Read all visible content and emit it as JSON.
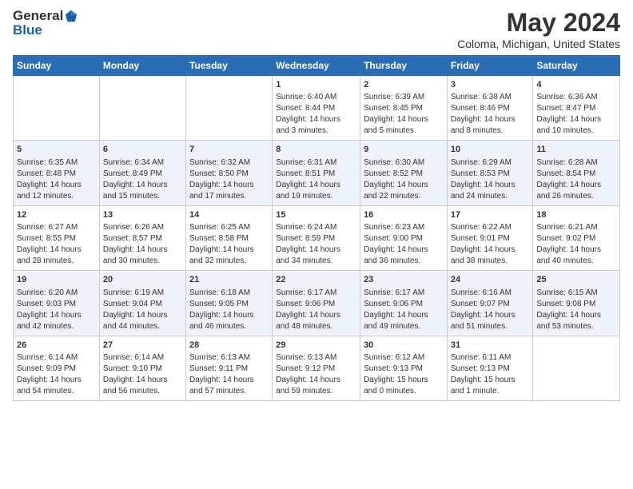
{
  "header": {
    "logo_general": "General",
    "logo_blue": "Blue",
    "title": "May 2024",
    "subtitle": "Coloma, Michigan, United States"
  },
  "days_of_week": [
    "Sunday",
    "Monday",
    "Tuesday",
    "Wednesday",
    "Thursday",
    "Friday",
    "Saturday"
  ],
  "weeks": [
    [
      {
        "day": "",
        "content": ""
      },
      {
        "day": "",
        "content": ""
      },
      {
        "day": "",
        "content": ""
      },
      {
        "day": "1",
        "content": "Sunrise: 6:40 AM\nSunset: 8:44 PM\nDaylight: 14 hours\nand 3 minutes."
      },
      {
        "day": "2",
        "content": "Sunrise: 6:39 AM\nSunset: 8:45 PM\nDaylight: 14 hours\nand 5 minutes."
      },
      {
        "day": "3",
        "content": "Sunrise: 6:38 AM\nSunset: 8:46 PM\nDaylight: 14 hours\nand 8 minutes."
      },
      {
        "day": "4",
        "content": "Sunrise: 6:36 AM\nSunset: 8:47 PM\nDaylight: 14 hours\nand 10 minutes."
      }
    ],
    [
      {
        "day": "5",
        "content": "Sunrise: 6:35 AM\nSunset: 8:48 PM\nDaylight: 14 hours\nand 12 minutes."
      },
      {
        "day": "6",
        "content": "Sunrise: 6:34 AM\nSunset: 8:49 PM\nDaylight: 14 hours\nand 15 minutes."
      },
      {
        "day": "7",
        "content": "Sunrise: 6:32 AM\nSunset: 8:50 PM\nDaylight: 14 hours\nand 17 minutes."
      },
      {
        "day": "8",
        "content": "Sunrise: 6:31 AM\nSunset: 8:51 PM\nDaylight: 14 hours\nand 19 minutes."
      },
      {
        "day": "9",
        "content": "Sunrise: 6:30 AM\nSunset: 8:52 PM\nDaylight: 14 hours\nand 22 minutes."
      },
      {
        "day": "10",
        "content": "Sunrise: 6:29 AM\nSunset: 8:53 PM\nDaylight: 14 hours\nand 24 minutes."
      },
      {
        "day": "11",
        "content": "Sunrise: 6:28 AM\nSunset: 8:54 PM\nDaylight: 14 hours\nand 26 minutes."
      }
    ],
    [
      {
        "day": "12",
        "content": "Sunrise: 6:27 AM\nSunset: 8:55 PM\nDaylight: 14 hours\nand 28 minutes."
      },
      {
        "day": "13",
        "content": "Sunrise: 6:26 AM\nSunset: 8:57 PM\nDaylight: 14 hours\nand 30 minutes."
      },
      {
        "day": "14",
        "content": "Sunrise: 6:25 AM\nSunset: 8:58 PM\nDaylight: 14 hours\nand 32 minutes."
      },
      {
        "day": "15",
        "content": "Sunrise: 6:24 AM\nSunset: 8:59 PM\nDaylight: 14 hours\nand 34 minutes."
      },
      {
        "day": "16",
        "content": "Sunrise: 6:23 AM\nSunset: 9:00 PM\nDaylight: 14 hours\nand 36 minutes."
      },
      {
        "day": "17",
        "content": "Sunrise: 6:22 AM\nSunset: 9:01 PM\nDaylight: 14 hours\nand 38 minutes."
      },
      {
        "day": "18",
        "content": "Sunrise: 6:21 AM\nSunset: 9:02 PM\nDaylight: 14 hours\nand 40 minutes."
      }
    ],
    [
      {
        "day": "19",
        "content": "Sunrise: 6:20 AM\nSunset: 9:03 PM\nDaylight: 14 hours\nand 42 minutes."
      },
      {
        "day": "20",
        "content": "Sunrise: 6:19 AM\nSunset: 9:04 PM\nDaylight: 14 hours\nand 44 minutes."
      },
      {
        "day": "21",
        "content": "Sunrise: 6:18 AM\nSunset: 9:05 PM\nDaylight: 14 hours\nand 46 minutes."
      },
      {
        "day": "22",
        "content": "Sunrise: 6:17 AM\nSunset: 9:06 PM\nDaylight: 14 hours\nand 48 minutes."
      },
      {
        "day": "23",
        "content": "Sunrise: 6:17 AM\nSunset: 9:06 PM\nDaylight: 14 hours\nand 49 minutes."
      },
      {
        "day": "24",
        "content": "Sunrise: 6:16 AM\nSunset: 9:07 PM\nDaylight: 14 hours\nand 51 minutes."
      },
      {
        "day": "25",
        "content": "Sunrise: 6:15 AM\nSunset: 9:08 PM\nDaylight: 14 hours\nand 53 minutes."
      }
    ],
    [
      {
        "day": "26",
        "content": "Sunrise: 6:14 AM\nSunset: 9:09 PM\nDaylight: 14 hours\nand 54 minutes."
      },
      {
        "day": "27",
        "content": "Sunrise: 6:14 AM\nSunset: 9:10 PM\nDaylight: 14 hours\nand 56 minutes."
      },
      {
        "day": "28",
        "content": "Sunrise: 6:13 AM\nSunset: 9:11 PM\nDaylight: 14 hours\nand 57 minutes."
      },
      {
        "day": "29",
        "content": "Sunrise: 6:13 AM\nSunset: 9:12 PM\nDaylight: 14 hours\nand 59 minutes."
      },
      {
        "day": "30",
        "content": "Sunrise: 6:12 AM\nSunset: 9:13 PM\nDaylight: 15 hours\nand 0 minutes."
      },
      {
        "day": "31",
        "content": "Sunrise: 6:11 AM\nSunset: 9:13 PM\nDaylight: 15 hours\nand 1 minute."
      },
      {
        "day": "",
        "content": ""
      }
    ]
  ]
}
